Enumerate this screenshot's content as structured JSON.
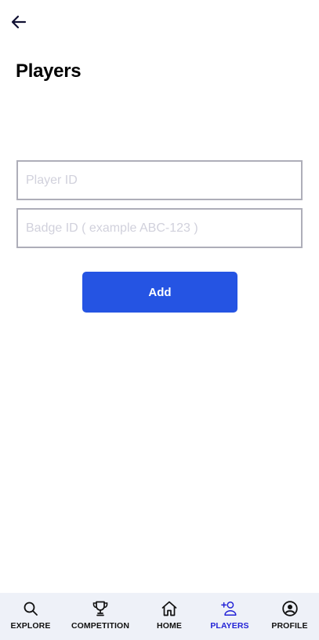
{
  "header": {
    "back_icon": "arrow-left-icon",
    "title": "Players"
  },
  "form": {
    "player_id_placeholder": "Player ID",
    "badge_id_placeholder": "Badge ID ( example ABC-123 )",
    "add_label": "Add"
  },
  "colors": {
    "primary": "#2554e3",
    "active_tab": "#2323d6",
    "tabbar_bg": "#eef1f8",
    "field_border": "#aeaeb9",
    "placeholder": "#d1d1dc"
  },
  "tabbar": {
    "active": "players",
    "items": [
      {
        "label": "EXPLORE",
        "icon": "search-icon"
      },
      {
        "label": "COMPETITION",
        "icon": "trophy-icon"
      },
      {
        "label": "HOME",
        "icon": "home-icon"
      },
      {
        "label": "PLAYERS",
        "icon": "add-user-icon"
      },
      {
        "label": "PROFILE",
        "icon": "user-circle-icon"
      }
    ]
  }
}
